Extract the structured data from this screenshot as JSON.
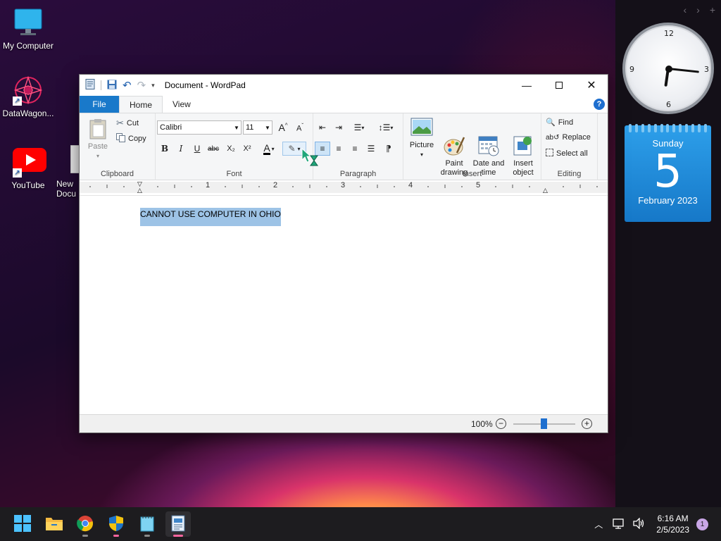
{
  "desktop": {
    "icons": [
      {
        "label": "My Computer",
        "icon": "monitor-icon"
      },
      {
        "label": "DataWagon...",
        "icon": "datawagon-icon"
      },
      {
        "label": "YouTube",
        "icon": "youtube-icon"
      },
      {
        "label": "New\nDocu",
        "icon": "document-icon"
      }
    ]
  },
  "widgets": {
    "clock": {
      "n12": "12",
      "n3": "3",
      "n6": "6",
      "n9": "9",
      "hour": 6,
      "minute": 16
    },
    "calendar": {
      "weekday": "Sunday",
      "day": "5",
      "month_year": "February 2023"
    }
  },
  "window": {
    "title": "Document - WordPad",
    "tabs": {
      "file": "File",
      "home": "Home",
      "view": "View"
    },
    "help": "?",
    "clipboard": {
      "label": "Clipboard",
      "paste": "Paste",
      "cut": "Cut",
      "copy": "Copy"
    },
    "font": {
      "label": "Font",
      "family": "Calibri",
      "size": "11",
      "bold": "B",
      "italic": "I",
      "underline": "U",
      "strike": "abc",
      "subscript": "X₂",
      "superscript": "X²"
    },
    "paragraph": {
      "label": "Paragraph"
    },
    "insert": {
      "label": "Insert",
      "picture": "Picture",
      "paint": "Paint\ndrawing",
      "datetime": "Date and\ntime",
      "object": "Insert\nobject"
    },
    "editing": {
      "label": "Editing",
      "find": "Find",
      "replace": "Replace",
      "select_all": "Select all"
    },
    "ruler": [
      "1",
      "2",
      "3",
      "4",
      "5"
    ],
    "document_text": "CANNOT USE COMPUTER IN OHIO",
    "zoom": "100%"
  },
  "taskbar": {
    "time": "6:16 AM",
    "date": "2/5/2023",
    "notifications": "1"
  },
  "colors": {
    "accent": "#1979ca",
    "selection": "#9dc3e6",
    "calendar": "#1e88d8"
  }
}
